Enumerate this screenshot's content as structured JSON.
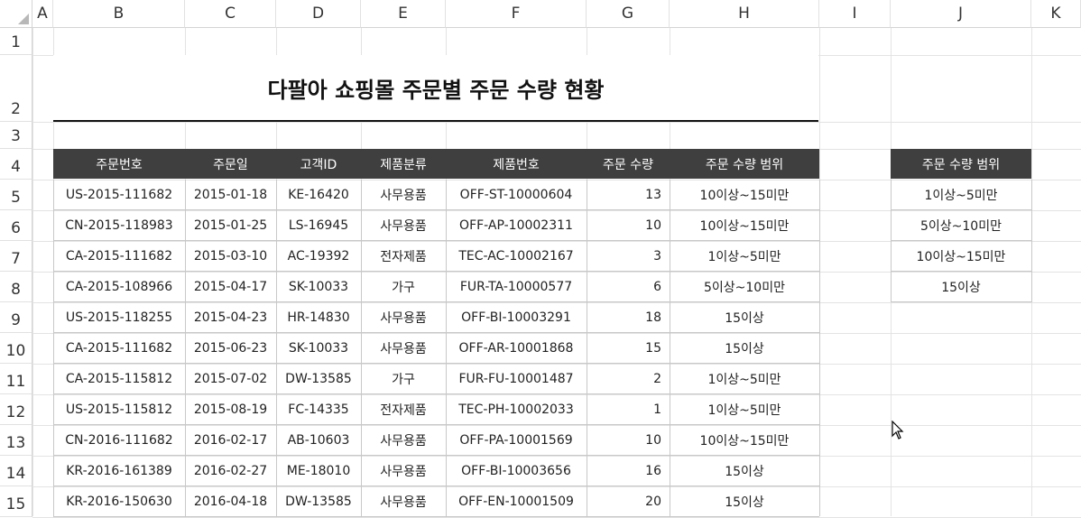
{
  "columns": [
    "A",
    "B",
    "C",
    "D",
    "E",
    "F",
    "G",
    "H",
    "I",
    "J",
    "K"
  ],
  "rows": [
    "1",
    "2",
    "3",
    "4",
    "5",
    "6",
    "7",
    "8",
    "9",
    "10",
    "11",
    "12",
    "13",
    "14",
    "15"
  ],
  "title": "다팔아 쇼핑몰 주문별 주문 수량 현황",
  "table": {
    "headers": [
      "주문번호",
      "주문일",
      "고객ID",
      "제품분류",
      "제품번호",
      "주문 수량",
      "주문 수량 범위"
    ],
    "rows": [
      [
        "US-2015-111682",
        "2015-01-18",
        "KE-16420",
        "사무용품",
        "OFF-ST-10000604",
        "13",
        "10이상~15미만"
      ],
      [
        "CN-2015-118983",
        "2015-01-25",
        "LS-16945",
        "사무용품",
        "OFF-AP-10002311",
        "10",
        "10이상~15미만"
      ],
      [
        "CA-2015-111682",
        "2015-03-10",
        "AC-19392",
        "전자제품",
        "TEC-AC-10002167",
        "3",
        "1이상~5미만"
      ],
      [
        "CA-2015-108966",
        "2015-04-17",
        "SK-10033",
        "가구",
        "FUR-TA-10000577",
        "6",
        "5이상~10미만"
      ],
      [
        "US-2015-118255",
        "2015-04-23",
        "HR-14830",
        "사무용품",
        "OFF-BI-10003291",
        "18",
        "15이상"
      ],
      [
        "CA-2015-111682",
        "2015-06-23",
        "SK-10033",
        "사무용품",
        "OFF-AR-10001868",
        "15",
        "15이상"
      ],
      [
        "CA-2015-115812",
        "2015-07-02",
        "DW-13585",
        "가구",
        "FUR-FU-10001487",
        "2",
        "1이상~5미만"
      ],
      [
        "US-2015-115812",
        "2015-08-19",
        "FC-14335",
        "전자제품",
        "TEC-PH-10002033",
        "1",
        "1이상~5미만"
      ],
      [
        "CN-2016-111682",
        "2016-02-17",
        "AB-10603",
        "사무용품",
        "OFF-PA-10001569",
        "10",
        "10이상~15미만"
      ],
      [
        "KR-2016-161389",
        "2016-02-27",
        "ME-18010",
        "사무용품",
        "OFF-BI-10003656",
        "16",
        "15이상"
      ],
      [
        "KR-2016-150630",
        "2016-04-18",
        "DW-13585",
        "사무용품",
        "OFF-EN-10001509",
        "20",
        "15이상"
      ]
    ]
  },
  "range_table": {
    "header": "주문 수량 범위",
    "items": [
      "1이상~5미만",
      "5이상~10미만",
      "10이상~15미만",
      "15이상"
    ]
  },
  "colors": {
    "header_bg": "#3f3f3f",
    "header_text": "#ffffff"
  },
  "icons": {
    "cursor": "mouse-pointer-icon"
  }
}
